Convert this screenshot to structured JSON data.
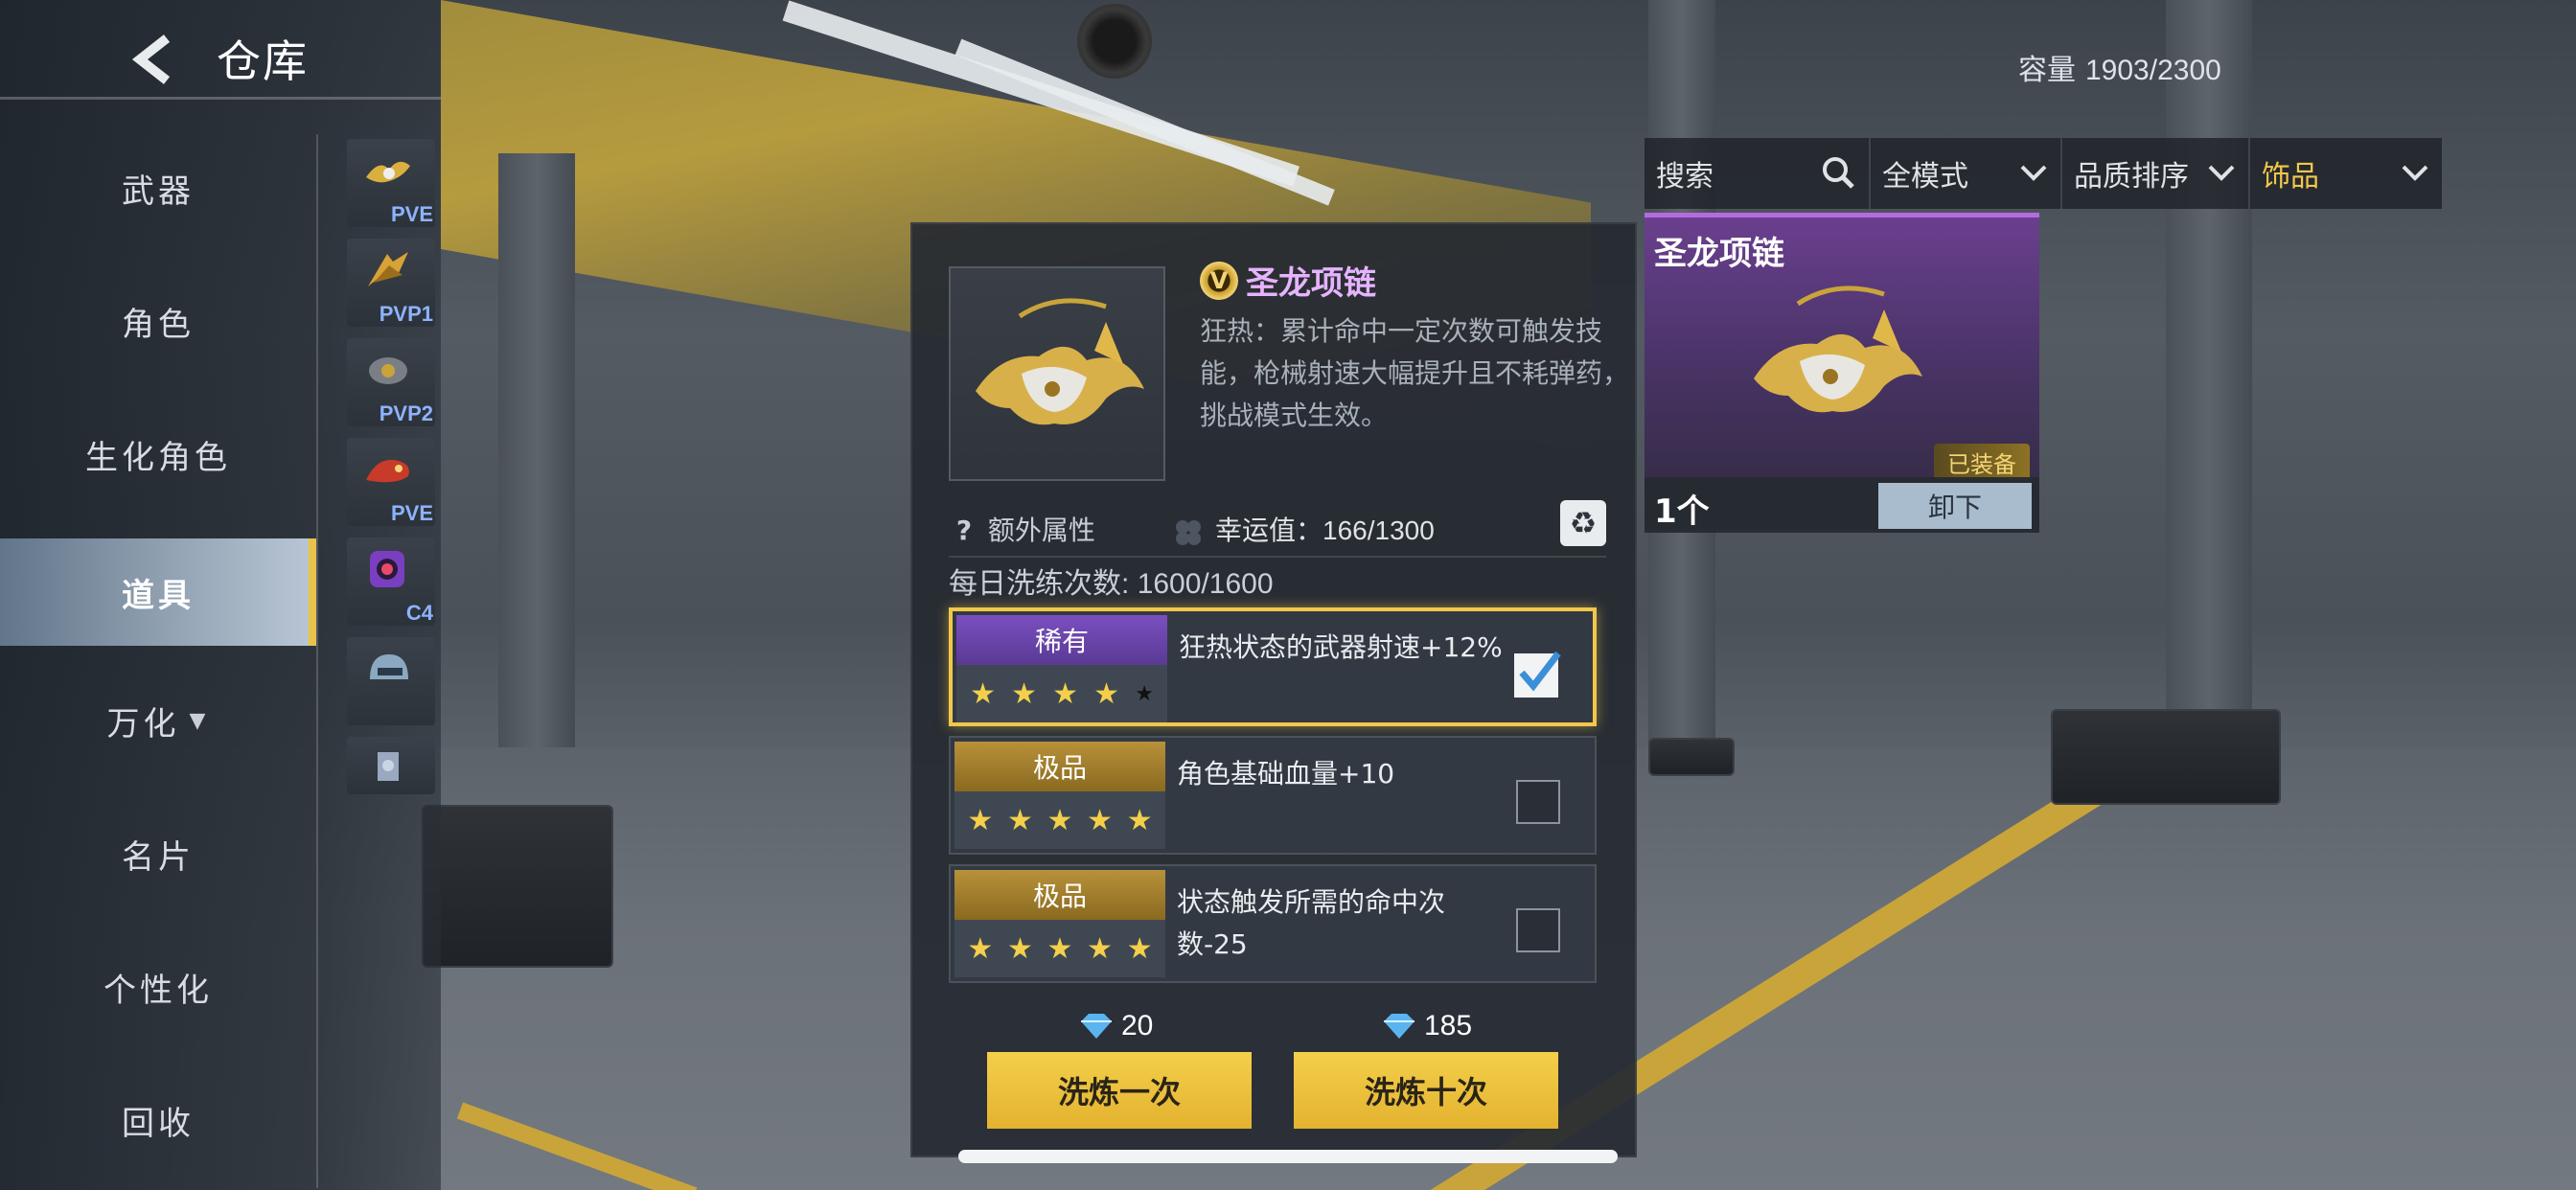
{
  "header": {
    "back_glyph": "<",
    "title": "仓库"
  },
  "capacity": {
    "label": "容量",
    "value": "1903/2300"
  },
  "nav": {
    "items": [
      {
        "label": "武器",
        "active": false
      },
      {
        "label": "角色",
        "active": false
      },
      {
        "label": "生化角色",
        "active": false
      },
      {
        "label": "道具",
        "active": true
      },
      {
        "label": "万化",
        "active": false
      },
      {
        "label": "名片",
        "active": false
      },
      {
        "label": "个性化",
        "active": false
      },
      {
        "label": "回收",
        "active": false
      }
    ],
    "dropdown_glyph": "▼"
  },
  "subnav": {
    "items": [
      {
        "tag": "PVE",
        "icon": "dragon-necklace-icon"
      },
      {
        "tag": "PVP1",
        "icon": "gold-wings-icon"
      },
      {
        "tag": "PVP2",
        "icon": "mech-pendant-icon"
      },
      {
        "tag": "PVE",
        "icon": "red-dragon-icon"
      },
      {
        "tag": "C4",
        "icon": "c4-device-icon"
      },
      {
        "tag": "",
        "icon": "helmet-icon"
      },
      {
        "tag": "",
        "icon": "charm-icon"
      }
    ]
  },
  "filters": {
    "search_placeholder": "搜索",
    "mode": "全模式",
    "sort": "品质排序",
    "category": "饰品"
  },
  "item_card": {
    "name": "圣龙项链",
    "equipped_label": "已装备",
    "count": "1个",
    "unequip_label": "卸下"
  },
  "detail": {
    "rank_letter": "V",
    "name": "圣龙项链",
    "description": "狂热：累计命中一定次数可触发技能，枪械射速大幅提升且不耗弹药，挑战模式生效。",
    "extra_attr_label": "额外属性",
    "help_glyph": "?",
    "luck_label": "幸运值：",
    "luck_value": "166/1300",
    "recycle_glyph": "♻",
    "daily_label": "每日洗练次数:",
    "daily_value": "1600/1600",
    "attributes": [
      {
        "tier": "稀有",
        "tier_color": "#7a4fc0",
        "stars": 4,
        "max_stars": 5,
        "text": "狂热状态的武器射速+12%",
        "checked": true
      },
      {
        "tier": "极品",
        "tier_color": "#b8913a",
        "stars": 5,
        "max_stars": 5,
        "text": "角色基础血量+10",
        "checked": false
      },
      {
        "tier": "极品",
        "tier_color": "#b8913a",
        "stars": 5,
        "max_stars": 5,
        "text": "状态触发所需的命中次数-25",
        "checked": false
      }
    ],
    "once": {
      "cost": "20",
      "label": "洗炼一次"
    },
    "ten": {
      "cost": "185",
      "label": "洗炼十次"
    }
  },
  "colors": {
    "accent_gold": "#f2c84b",
    "rare_purple": "#7a4fc0",
    "item_name_purple": "#e6b3ff"
  }
}
